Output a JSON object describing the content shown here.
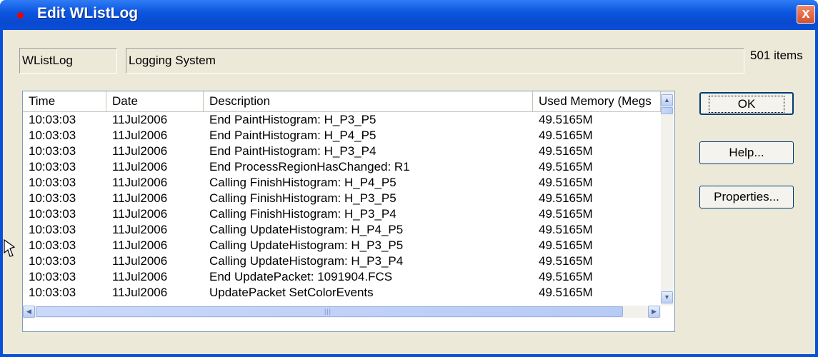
{
  "window": {
    "title": "Edit WListLog",
    "close_glyph": "x"
  },
  "fields": {
    "name": "WListLog",
    "description": "Logging System",
    "count": "501 items"
  },
  "list": {
    "columns": [
      "Time",
      "Date",
      "Description",
      "Used Memory (Megs"
    ],
    "rows": [
      [
        "10:03:03",
        "11Jul2006",
        "End PaintHistogram: H_P3_P5",
        "49.5165M"
      ],
      [
        "10:03:03",
        "11Jul2006",
        "End PaintHistogram: H_P4_P5",
        "49.5165M"
      ],
      [
        "10:03:03",
        "11Jul2006",
        "End PaintHistogram: H_P3_P4",
        "49.5165M"
      ],
      [
        "10:03:03",
        "11Jul2006",
        "End ProcessRegionHasChanged: R1",
        "49.5165M"
      ],
      [
        "10:03:03",
        "11Jul2006",
        "Calling FinishHistogram: H_P4_P5",
        "49.5165M"
      ],
      [
        "10:03:03",
        "11Jul2006",
        "Calling FinishHistogram: H_P3_P5",
        "49.5165M"
      ],
      [
        "10:03:03",
        "11Jul2006",
        "Calling FinishHistogram: H_P3_P4",
        "49.5165M"
      ],
      [
        "10:03:03",
        "11Jul2006",
        "Calling UpdateHistogram: H_P4_P5",
        "49.5165M"
      ],
      [
        "10:03:03",
        "11Jul2006",
        "Calling UpdateHistogram: H_P3_P5",
        "49.5165M"
      ],
      [
        "10:03:03",
        "11Jul2006",
        "Calling UpdateHistogram: H_P3_P4",
        "49.5165M"
      ],
      [
        "10:03:03",
        "11Jul2006",
        "End UpdatePacket: 1091904.FCS",
        "49.5165M"
      ],
      [
        "10:03:03",
        "11Jul2006",
        "UpdatePacket SetColorEvents",
        "49.5165M"
      ]
    ]
  },
  "buttons": {
    "ok": "OK",
    "help": "Help...",
    "properties": "Properties..."
  },
  "icons": {
    "title": "red-dot-icon",
    "close": "close-icon",
    "scroll_up": "arrow-up-icon",
    "scroll_down": "arrow-down-icon",
    "scroll_left": "arrow-left-icon",
    "scroll_right": "arrow-right-icon",
    "cursor": "mouse-pointer-icon"
  },
  "colors": {
    "title_bar": "#0a4fd8",
    "dialog_face": "#ece9d8",
    "close_button": "#e0603c",
    "button_border": "#003c74"
  }
}
